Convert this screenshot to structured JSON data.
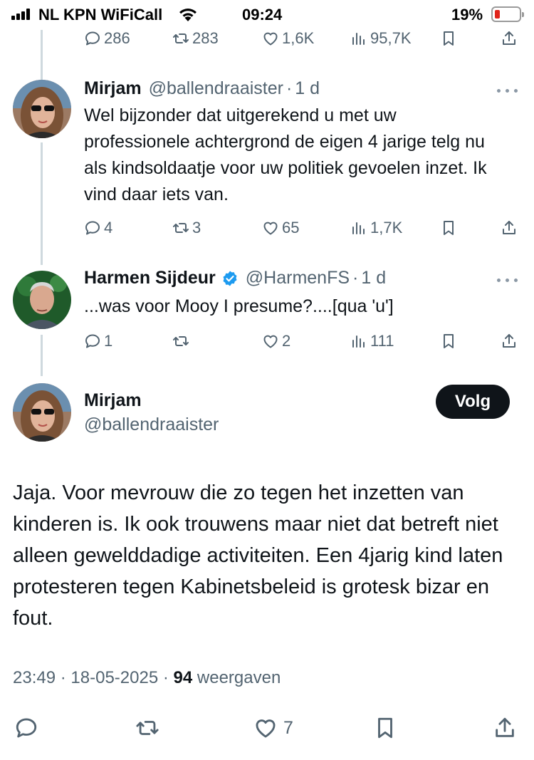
{
  "status_bar": {
    "carrier": "NL KPN WiFiCall",
    "time": "09:24",
    "battery_percent": "19%",
    "battery_level": 0.19
  },
  "top_actions": {
    "replies": "286",
    "reposts": "283",
    "likes": "1,6K",
    "views": "95,7K"
  },
  "reply1": {
    "name": "Mirjam",
    "handle": "@ballendraaister",
    "separator": "·",
    "time": "1 d",
    "text": "Wel bijzonder dat uitgerekend u met uw professionele achtergrond de eigen 4 jarige telg nu als kindsoldaatje voor uw politiek gevoelen inzet. Ik vind daar iets van.",
    "replies": "4",
    "reposts": "3",
    "likes": "65",
    "views": "1,7K"
  },
  "reply2": {
    "name": "Harmen Sijdeur",
    "handle": "@HarmenFS",
    "separator": "·",
    "time": "1 d",
    "text": "...was voor Mooy I presume?....[qua 'u']",
    "replies": "1",
    "reposts": "",
    "likes": "2",
    "views": "111"
  },
  "main_tweet": {
    "name": "Mirjam",
    "handle": "@ballendraaister",
    "follow_label": "Volg",
    "text": "Jaja. Voor mevrouw die zo tegen het inzetten van kinderen is. Ik ook trouwens maar niet dat betreft niet alleen gewelddadige activiteiten. Een 4jarig kind laten protesteren tegen Kabinetsbeleid is grotesk bizar en fout.",
    "time": "23:49",
    "date": "18-05-2025",
    "views_count": "94",
    "views_label": "weergaven",
    "likes": "7"
  },
  "icons": [
    "signal-icon",
    "wifi-icon",
    "battery-icon",
    "reply-icon",
    "repost-icon",
    "like-icon",
    "views-icon",
    "bookmark-icon",
    "share-icon",
    "more-icon",
    "verified-icon"
  ],
  "colors": {
    "text": "#0f1419",
    "secondary": "#536471",
    "verified": "#1d9bf0",
    "battery_low": "#e0241b",
    "follow_bg": "#0f1419"
  }
}
